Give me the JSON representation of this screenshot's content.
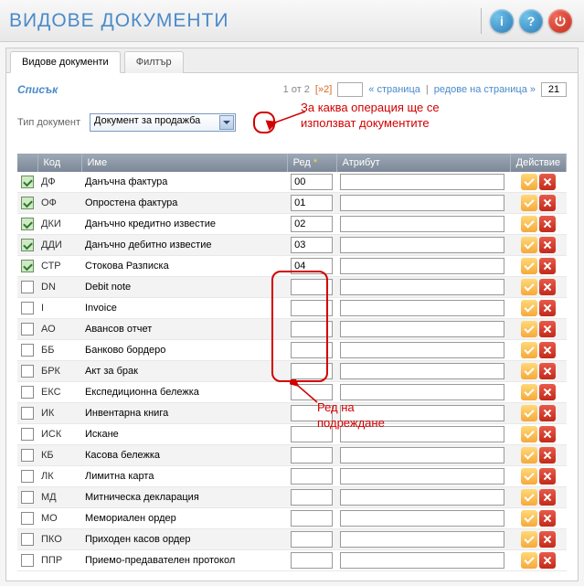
{
  "header": {
    "title": "ВИДОВЕ ДОКУМЕНТИ"
  },
  "tabs": {
    "main": "Видове документи",
    "filter": "Филтър"
  },
  "list": {
    "title": "Списък",
    "page_text": "1 от 2",
    "next_label": "[»2]",
    "page_input": "",
    "pager_links_a": "« страница",
    "pager_links_b": "редове на страница »",
    "rows_input": "21"
  },
  "type": {
    "label": "Тип документ",
    "value": "Документ за продажба"
  },
  "annotations": {
    "a1_line1": "За каква операция ще се",
    "a1_line2": "използват документите",
    "a2_line1": "Ред на",
    "a2_line2": "подреждане"
  },
  "columns": {
    "chk": "",
    "code": "Код",
    "name": "Име",
    "ord": "Ред",
    "ord_star": "*",
    "attr": "Атрибут",
    "action": "Действие"
  },
  "rows": [
    {
      "checked": true,
      "code": "ДФ",
      "name": "Данъчна фактура",
      "ord": "00",
      "attr": ""
    },
    {
      "checked": true,
      "code": "ОФ",
      "name": "Опростена фактура",
      "ord": "01",
      "attr": ""
    },
    {
      "checked": true,
      "code": "ДКИ",
      "name": "Данъчно кредитно известие",
      "ord": "02",
      "attr": ""
    },
    {
      "checked": true,
      "code": "ДДИ",
      "name": "Данъчно дебитно известие",
      "ord": "03",
      "attr": ""
    },
    {
      "checked": true,
      "code": "СТР",
      "name": "Стокова Разписка",
      "ord": "04",
      "attr": ""
    },
    {
      "checked": false,
      "code": "DN",
      "name": "Debit note",
      "ord": "",
      "attr": ""
    },
    {
      "checked": false,
      "code": "I",
      "name": "Invoice",
      "ord": "",
      "attr": ""
    },
    {
      "checked": false,
      "code": "АО",
      "name": "Авансов отчет",
      "ord": "",
      "attr": ""
    },
    {
      "checked": false,
      "code": "ББ",
      "name": "Банково бордеро",
      "ord": "",
      "attr": ""
    },
    {
      "checked": false,
      "code": "БРК",
      "name": "Акт за брак",
      "ord": "",
      "attr": ""
    },
    {
      "checked": false,
      "code": "ЕКС",
      "name": "Експедиционна бележка",
      "ord": "",
      "attr": ""
    },
    {
      "checked": false,
      "code": "ИК",
      "name": "Инвентарна книга",
      "ord": "",
      "attr": ""
    },
    {
      "checked": false,
      "code": "ИСК",
      "name": "Искане",
      "ord": "",
      "attr": ""
    },
    {
      "checked": false,
      "code": "КБ",
      "name": "Касова бележка",
      "ord": "",
      "attr": ""
    },
    {
      "checked": false,
      "code": "ЛК",
      "name": "Лимитна карта",
      "ord": "",
      "attr": ""
    },
    {
      "checked": false,
      "code": "МД",
      "name": "Митническа декларация",
      "ord": "",
      "attr": ""
    },
    {
      "checked": false,
      "code": "МО",
      "name": "Мемориален ордер",
      "ord": "",
      "attr": ""
    },
    {
      "checked": false,
      "code": "ПКО",
      "name": "Приходен касов ордер",
      "ord": "",
      "attr": ""
    },
    {
      "checked": false,
      "code": "ППР",
      "name": "Приемо-предавателен протокол",
      "ord": "",
      "attr": ""
    }
  ]
}
